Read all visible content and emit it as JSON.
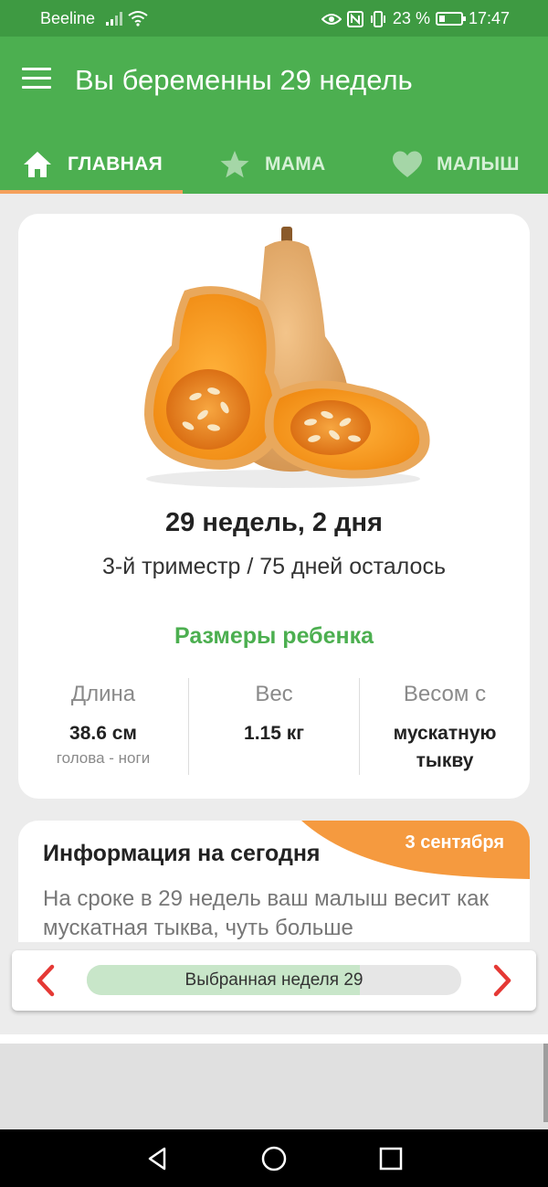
{
  "status_bar": {
    "carrier": "Beeline",
    "battery_percent": "23 %",
    "time": "17:47",
    "icons": [
      "signal-icon",
      "wifi-icon",
      "eye-icon",
      "nfc-icon",
      "vibrate-icon",
      "battery-icon"
    ]
  },
  "app_bar": {
    "title": "Вы беременны 29 недель",
    "menu_icon": "menu-icon"
  },
  "tabs": [
    {
      "label": "ГЛАВНАЯ",
      "icon": "home-icon",
      "active": true
    },
    {
      "label": "МАМА",
      "icon": "star-icon",
      "active": false
    },
    {
      "label": "МАЛЫШ",
      "icon": "heart-icon",
      "active": false
    }
  ],
  "colors": {
    "app_bar": "#4caf50",
    "status_bar": "#3e9a42",
    "accent_orange": "#f59a3f",
    "tab_indicator": "#f5a05c",
    "nav_arrow_red": "#e53935"
  },
  "main_card": {
    "image": "butternut-squash",
    "week_title": "29 недель, 2 дня",
    "trimester_text": "3-й триместр / 75 дней осталось",
    "sizes_title": "Размеры ребенка",
    "stats": [
      {
        "label": "Длина",
        "value": "38.6 см",
        "sub": "голова - ноги"
      },
      {
        "label": "Вес",
        "value": "1.15 кг",
        "sub": ""
      },
      {
        "label": "Весом с",
        "value_line1": "мускатную",
        "value_line2": "тыкву"
      }
    ]
  },
  "info_card": {
    "date": "3 сентября",
    "title": "Информация на сегодня",
    "text": "На сроке в 29 недель ваш малыш весит как мускатная тыква, чуть больше"
  },
  "week_selector": {
    "label": "Выбранная неделя 29",
    "week": 29,
    "progress": 0.73
  }
}
